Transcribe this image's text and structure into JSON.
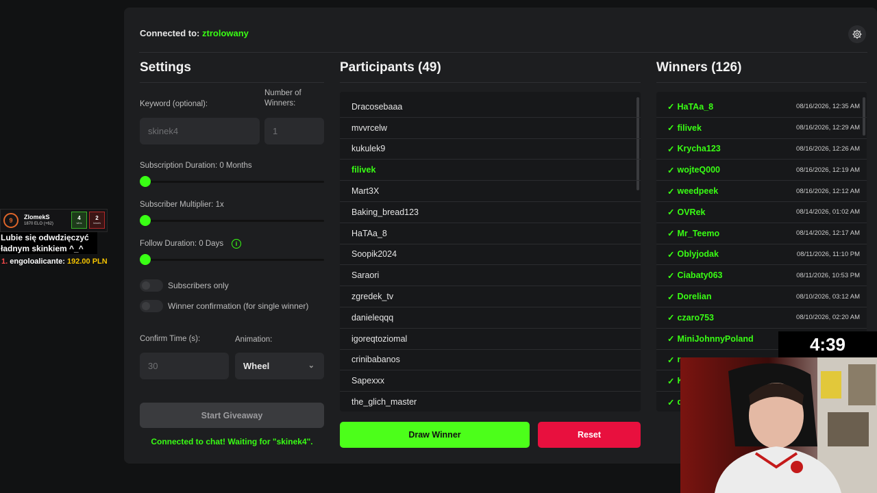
{
  "header": {
    "connected_prefix": "Connected to:",
    "channel": "ztrolowany"
  },
  "settings": {
    "title": "Settings",
    "keyword_label": "Keyword (optional):",
    "keyword_placeholder": "skinek4",
    "winners_label_1": "Number of",
    "winners_label_2": "Winners:",
    "winners_value": "1",
    "sub_duration_label": "Subscription Duration: 0 Months",
    "sub_duration_value": 0,
    "sub_multiplier_label": "Subscriber Multiplier: 1x",
    "follow_duration_label": "Follow Duration:  0  Days",
    "info_glyph": "i",
    "subs_only_label": "Subscribers only",
    "winner_confirm_label": "Winner confirmation (for single winner)",
    "confirm_time_label": "Confirm Time (s):",
    "confirm_time_value": "30",
    "animation_label": "Animation:",
    "animation_value": "Wheel",
    "start_button": "Start Giveaway",
    "status_text": "Connected to chat! Waiting for \"skinek4\"."
  },
  "participants": {
    "title": "Participants (49)",
    "items": [
      {
        "name": "Dracosebaaa",
        "hl": false
      },
      {
        "name": "mvvrcelw",
        "hl": false
      },
      {
        "name": "kukulek9",
        "hl": false
      },
      {
        "name": "filivek",
        "hl": true
      },
      {
        "name": "Mart3X",
        "hl": false
      },
      {
        "name": "Baking_bread123",
        "hl": false
      },
      {
        "name": "HaTAa_8",
        "hl": false
      },
      {
        "name": "Soopik2024",
        "hl": false
      },
      {
        "name": "Saraori",
        "hl": false
      },
      {
        "name": "zgredek_tv",
        "hl": false
      },
      {
        "name": "danieleqqq",
        "hl": false
      },
      {
        "name": "igoreqtoziomal",
        "hl": false
      },
      {
        "name": "crinibabanos",
        "hl": false
      },
      {
        "name": "Sapexxx",
        "hl": false
      },
      {
        "name": "the_glich_master",
        "hl": false
      }
    ]
  },
  "winners": {
    "title": "Winners (126)",
    "check": "✓",
    "items": [
      {
        "name": "HaTAa_8",
        "date": "08/16/2026, 12:35 AM"
      },
      {
        "name": "filivek",
        "date": "08/16/2026, 12:29 AM"
      },
      {
        "name": "Krycha123",
        "date": "08/16/2026, 12:26 AM"
      },
      {
        "name": "wojteQ000",
        "date": "08/16/2026, 12:19 AM"
      },
      {
        "name": "weedpeek",
        "date": "08/16/2026, 12:12 AM"
      },
      {
        "name": "OVRek",
        "date": "08/14/2026, 01:02 AM"
      },
      {
        "name": "Mr_Teemo",
        "date": "08/14/2026, 12:17 AM"
      },
      {
        "name": "Oblyjodak",
        "date": "08/11/2026, 11:10 PM"
      },
      {
        "name": "Ciabaty063",
        "date": "08/11/2026, 10:53 PM"
      },
      {
        "name": "Dorelian",
        "date": "08/10/2026, 03:12 AM"
      },
      {
        "name": "czaro753",
        "date": "08/10/2026, 02:20 AM"
      },
      {
        "name": "MiniJohnnyPoland",
        "date": ""
      },
      {
        "name": "n",
        "date": ""
      },
      {
        "name": "K",
        "date": ""
      },
      {
        "name": "d",
        "date": ""
      }
    ]
  },
  "actions": {
    "draw": "Draw Winner",
    "reset": "Reset"
  },
  "overlay": {
    "level": "9",
    "player": "ZlomekS",
    "elo": "1870 ELO (+62)",
    "wins": "4",
    "wins_label": "wins",
    "losses": "2",
    "losses_label": "losses",
    "chat_msg": "Lubie się odwdzięczyć ładnym skinkiem ^_^",
    "donation_rank": "1.",
    "donation_user": "engoloalicante:",
    "donation_amount": "192.00 PLN",
    "timer": "4:39"
  },
  "colors": {
    "accent": "#39ff14",
    "danger": "#e8103e",
    "panel": "#1d1e20"
  }
}
